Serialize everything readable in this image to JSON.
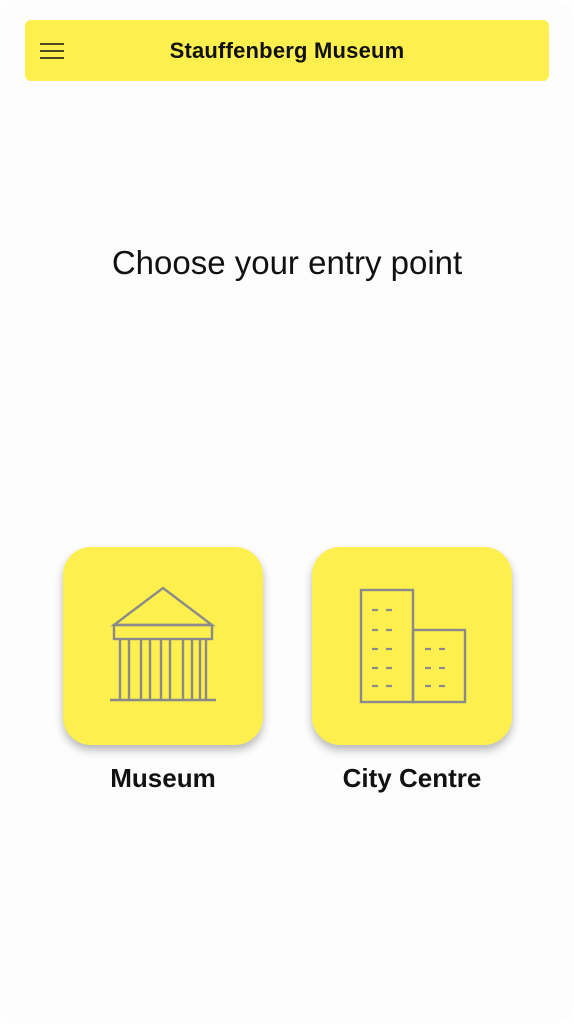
{
  "header": {
    "title": "Stauffenberg Museum",
    "menu_icon": "hamburger-menu-icon",
    "background": "#fcef4e"
  },
  "main": {
    "heading": "Choose your entry point",
    "options": [
      {
        "label": "Museum",
        "icon": "museum-building-icon",
        "tile_color": "#fcef4e"
      },
      {
        "label": "City Centre",
        "icon": "city-buildings-icon",
        "tile_color": "#fcef4e"
      }
    ]
  },
  "colors": {
    "accent": "#fcef4e",
    "icon_stroke": "#8a8a8a",
    "text": "#111111"
  }
}
